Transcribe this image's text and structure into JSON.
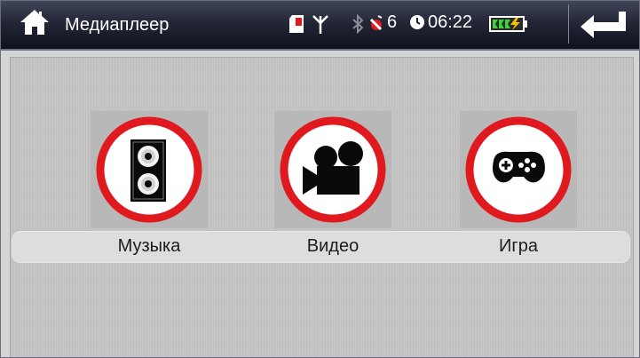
{
  "header": {
    "title": "Медиаплеер",
    "home_icon": "home-icon",
    "back_icon": "back-arrow-icon"
  },
  "status_bar": {
    "sd_card_icon": "sd-card-icon",
    "antenna_icon": "antenna-icon",
    "bluetooth_icon": "bluetooth-icon",
    "satellite_icon": "satellite-icon",
    "satellite_count": "6",
    "clock_icon": "clock-icon",
    "time": "06:22",
    "battery_icon": "battery-charging-icon"
  },
  "menu": {
    "items": [
      {
        "label": "Музыка",
        "icon": "speaker-icon"
      },
      {
        "label": "Видео",
        "icon": "video-camera-icon"
      },
      {
        "label": "Игра",
        "icon": "gamepad-icon"
      }
    ]
  },
  "colors": {
    "ring_red": "#e0191f",
    "header_dark": "#1e2130",
    "battery_green": "#3cd23c",
    "battery_bolt": "#f5c400",
    "sd_red": "#e0191f"
  }
}
